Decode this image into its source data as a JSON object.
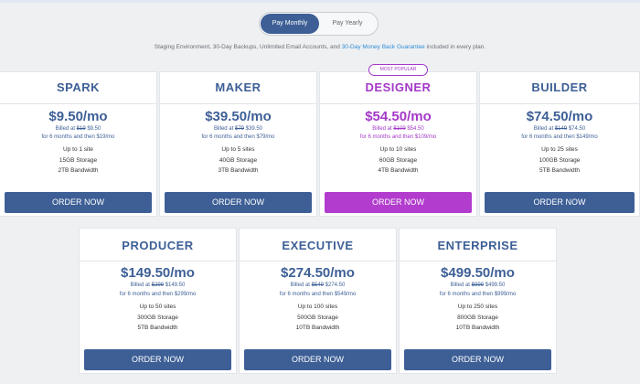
{
  "toggle": {
    "monthly_label": "Pay Monthly",
    "yearly_label": "Pay Yearly"
  },
  "features": {
    "text_before": "Staging Environment, 30-Day Backups, Unlimited Email Accounts, and ",
    "link_text": "30-Day Money Back Guarantee",
    "text_after": " included in every plan."
  },
  "badge": "MOST POPULAR",
  "colors": {
    "primary": "#3d5f96",
    "popular": "#a338c8",
    "popular_button": "#b23ccd",
    "link": "#2f8ed8"
  },
  "plans": [
    {
      "name": "SPARK",
      "price": "$9.50/mo",
      "billed_prefix": "Billed at ",
      "billed_old": "$19",
      "billed_new": " $9.50",
      "then": "for 6 months and then $19/mo",
      "sites": "Up to 1 site",
      "storage": "15GB Storage",
      "bandwidth": "2TB Bandwidth",
      "button": "ORDER NOW"
    },
    {
      "name": "MAKER",
      "price": "$39.50/mo",
      "billed_prefix": "Billed at ",
      "billed_old": "$79",
      "billed_new": " $39.50",
      "then": "for 6 months and then $79/mo",
      "sites": "Up to 5 sites",
      "storage": "40GB Storage",
      "bandwidth": "3TB Bandwidth",
      "button": "ORDER NOW"
    },
    {
      "name": "DESIGNER",
      "price": "$54.50/mo",
      "billed_prefix": "Billed at ",
      "billed_old": "$109",
      "billed_new": " $54.50",
      "then": "for 6 months and then $109/mo",
      "sites": "Up to 10 sites",
      "storage": "60GB Storage",
      "bandwidth": "4TB Bandwidth",
      "button": "ORDER NOW"
    },
    {
      "name": "BUILDER",
      "price": "$74.50/mo",
      "billed_prefix": "Billed at ",
      "billed_old": "$149",
      "billed_new": " $74.50",
      "then": "for 6 months and then $149/mo",
      "sites": "Up to 25 sites",
      "storage": "100GB Storage",
      "bandwidth": "5TB Bandwidth",
      "button": "ORDER NOW"
    },
    {
      "name": "PRODUCER",
      "price": "$149.50/mo",
      "billed_prefix": "Billed at ",
      "billed_old": "$299",
      "billed_new": " $149.50",
      "then": "for 6 months and then $299/mo",
      "sites": "Up to 50 sites",
      "storage": "300GB Storage",
      "bandwidth": "5TB Bandwidth",
      "button": "ORDER NOW"
    },
    {
      "name": "EXECUTIVE",
      "price": "$274.50/mo",
      "billed_prefix": "Billed at ",
      "billed_old": "$549",
      "billed_new": " $274.50",
      "then": "for 6 months and then $549/mo",
      "sites": "Up to 100 sites",
      "storage": "500GB Storage",
      "bandwidth": "10TB Bandwidth",
      "button": "ORDER NOW"
    },
    {
      "name": "ENTERPRISE",
      "price": "$499.50/mo",
      "billed_prefix": "Billed at ",
      "billed_old": "$999",
      "billed_new": " $499.50",
      "then": "for 6 months and then $999/mo",
      "sites": "Up to 250 sites",
      "storage": "800GB Storage",
      "bandwidth": "10TB Bandwidth",
      "button": "ORDER NOW"
    }
  ]
}
